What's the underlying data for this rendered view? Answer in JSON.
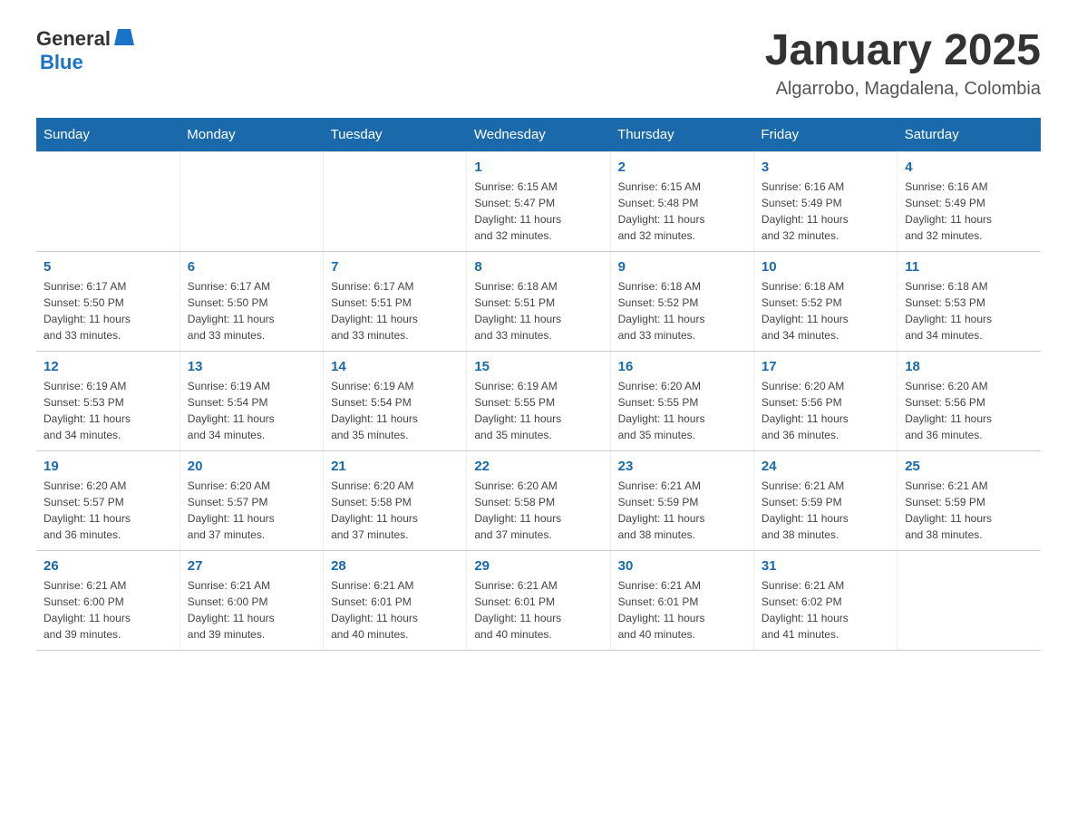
{
  "header": {
    "logo_general": "General",
    "logo_blue": "Blue",
    "title": "January 2025",
    "subtitle": "Algarrobo, Magdalena, Colombia"
  },
  "days_of_week": [
    "Sunday",
    "Monday",
    "Tuesday",
    "Wednesday",
    "Thursday",
    "Friday",
    "Saturday"
  ],
  "weeks": [
    [
      {
        "day": "",
        "info": ""
      },
      {
        "day": "",
        "info": ""
      },
      {
        "day": "",
        "info": ""
      },
      {
        "day": "1",
        "info": "Sunrise: 6:15 AM\nSunset: 5:47 PM\nDaylight: 11 hours\nand 32 minutes."
      },
      {
        "day": "2",
        "info": "Sunrise: 6:15 AM\nSunset: 5:48 PM\nDaylight: 11 hours\nand 32 minutes."
      },
      {
        "day": "3",
        "info": "Sunrise: 6:16 AM\nSunset: 5:49 PM\nDaylight: 11 hours\nand 32 minutes."
      },
      {
        "day": "4",
        "info": "Sunrise: 6:16 AM\nSunset: 5:49 PM\nDaylight: 11 hours\nand 32 minutes."
      }
    ],
    [
      {
        "day": "5",
        "info": "Sunrise: 6:17 AM\nSunset: 5:50 PM\nDaylight: 11 hours\nand 33 minutes."
      },
      {
        "day": "6",
        "info": "Sunrise: 6:17 AM\nSunset: 5:50 PM\nDaylight: 11 hours\nand 33 minutes."
      },
      {
        "day": "7",
        "info": "Sunrise: 6:17 AM\nSunset: 5:51 PM\nDaylight: 11 hours\nand 33 minutes."
      },
      {
        "day": "8",
        "info": "Sunrise: 6:18 AM\nSunset: 5:51 PM\nDaylight: 11 hours\nand 33 minutes."
      },
      {
        "day": "9",
        "info": "Sunrise: 6:18 AM\nSunset: 5:52 PM\nDaylight: 11 hours\nand 33 minutes."
      },
      {
        "day": "10",
        "info": "Sunrise: 6:18 AM\nSunset: 5:52 PM\nDaylight: 11 hours\nand 34 minutes."
      },
      {
        "day": "11",
        "info": "Sunrise: 6:18 AM\nSunset: 5:53 PM\nDaylight: 11 hours\nand 34 minutes."
      }
    ],
    [
      {
        "day": "12",
        "info": "Sunrise: 6:19 AM\nSunset: 5:53 PM\nDaylight: 11 hours\nand 34 minutes."
      },
      {
        "day": "13",
        "info": "Sunrise: 6:19 AM\nSunset: 5:54 PM\nDaylight: 11 hours\nand 34 minutes."
      },
      {
        "day": "14",
        "info": "Sunrise: 6:19 AM\nSunset: 5:54 PM\nDaylight: 11 hours\nand 35 minutes."
      },
      {
        "day": "15",
        "info": "Sunrise: 6:19 AM\nSunset: 5:55 PM\nDaylight: 11 hours\nand 35 minutes."
      },
      {
        "day": "16",
        "info": "Sunrise: 6:20 AM\nSunset: 5:55 PM\nDaylight: 11 hours\nand 35 minutes."
      },
      {
        "day": "17",
        "info": "Sunrise: 6:20 AM\nSunset: 5:56 PM\nDaylight: 11 hours\nand 36 minutes."
      },
      {
        "day": "18",
        "info": "Sunrise: 6:20 AM\nSunset: 5:56 PM\nDaylight: 11 hours\nand 36 minutes."
      }
    ],
    [
      {
        "day": "19",
        "info": "Sunrise: 6:20 AM\nSunset: 5:57 PM\nDaylight: 11 hours\nand 36 minutes."
      },
      {
        "day": "20",
        "info": "Sunrise: 6:20 AM\nSunset: 5:57 PM\nDaylight: 11 hours\nand 37 minutes."
      },
      {
        "day": "21",
        "info": "Sunrise: 6:20 AM\nSunset: 5:58 PM\nDaylight: 11 hours\nand 37 minutes."
      },
      {
        "day": "22",
        "info": "Sunrise: 6:20 AM\nSunset: 5:58 PM\nDaylight: 11 hours\nand 37 minutes."
      },
      {
        "day": "23",
        "info": "Sunrise: 6:21 AM\nSunset: 5:59 PM\nDaylight: 11 hours\nand 38 minutes."
      },
      {
        "day": "24",
        "info": "Sunrise: 6:21 AM\nSunset: 5:59 PM\nDaylight: 11 hours\nand 38 minutes."
      },
      {
        "day": "25",
        "info": "Sunrise: 6:21 AM\nSunset: 5:59 PM\nDaylight: 11 hours\nand 38 minutes."
      }
    ],
    [
      {
        "day": "26",
        "info": "Sunrise: 6:21 AM\nSunset: 6:00 PM\nDaylight: 11 hours\nand 39 minutes."
      },
      {
        "day": "27",
        "info": "Sunrise: 6:21 AM\nSunset: 6:00 PM\nDaylight: 11 hours\nand 39 minutes."
      },
      {
        "day": "28",
        "info": "Sunrise: 6:21 AM\nSunset: 6:01 PM\nDaylight: 11 hours\nand 40 minutes."
      },
      {
        "day": "29",
        "info": "Sunrise: 6:21 AM\nSunset: 6:01 PM\nDaylight: 11 hours\nand 40 minutes."
      },
      {
        "day": "30",
        "info": "Sunrise: 6:21 AM\nSunset: 6:01 PM\nDaylight: 11 hours\nand 40 minutes."
      },
      {
        "day": "31",
        "info": "Sunrise: 6:21 AM\nSunset: 6:02 PM\nDaylight: 11 hours\nand 41 minutes."
      },
      {
        "day": "",
        "info": ""
      }
    ]
  ]
}
